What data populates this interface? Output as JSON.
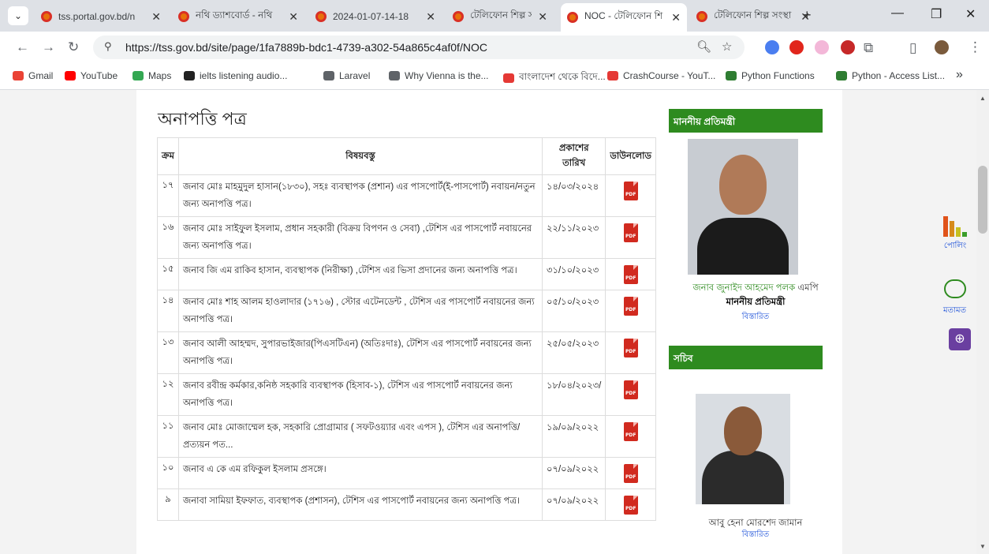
{
  "browser": {
    "tabs": [
      {
        "title": "tss.portal.gov.bd/n",
        "active": false
      },
      {
        "title": "নথি ড্যাশবোর্ড - নথি",
        "active": false
      },
      {
        "title": "2024-01-07-14-18",
        "active": false
      },
      {
        "title": "টেলিফোন শিল্প সংস্থা",
        "active": false
      },
      {
        "title": "NOC - টেলিফোন শি",
        "active": true
      },
      {
        "title": "টেলিফোন শিল্প সংস্থা",
        "active": false
      }
    ],
    "new_tab": "+",
    "url": "https://tss.gov.bd/site/page/1fa7889b-bdc1-4739-a302-54a865c4af0f/NOC",
    "bookmarks": [
      "Gmail",
      "YouTube",
      "Maps",
      "ielts listening audio...",
      "Laravel",
      "Why Vienna is the...",
      "বাংলাদেশ থেকে বিদে...",
      "CrashCourse - YouT...",
      "Python Functions",
      "Python - Access List..."
    ],
    "more_bookmarks": "»",
    "accent": "#2e8b1f"
  },
  "page": {
    "title": "অনাপত্তি পত্র",
    "table_headers": [
      "ক্রম",
      "বিষয়বস্তু",
      "প্রকাশের তারিখ",
      "ডাউনলোড"
    ],
    "rows": [
      {
        "sl": "১৭",
        "subject": "জনাব মোঃ মাহমুদুল হাসান(১৮৩০), সহঃ ব্যবস্থাপক (প্রশান) এর পাসপোর্ট(ই-পাসপোর্ট) নবায়ন/নতুন জন্য অনাপত্তি পত্র।",
        "date": "১৪/০৩/২০২৪"
      },
      {
        "sl": "১৬",
        "subject": "জনাব মোঃ সাইফুল ইসলাম, প্রধান সহকারী (বিক্রয় বিপণন ও সেবা) ,টেশিস এর পাসপোর্ট নবায়নের জন্য অনাপত্তি পত্র।",
        "date": "২২/১১/২০২৩"
      },
      {
        "sl": "১৫",
        "subject": "জনাব জি এম রাকিব হাসান, ব্যবস্থাপক (নিরীক্ষা) ,টেশিস এর ভিসা প্রদানের জন্য অনাপত্তি পত্র।",
        "date": "৩১/১০/২০২৩"
      },
      {
        "sl": "১৪",
        "subject": "জনাব মোঃ শাহ আলম হাওলাদার (১৭১৬) , স্টোর এটেনডেন্ট , টেশিস এর পাসপোর্ট নবায়নের জন্য অনাপত্তি পত্র।",
        "date": "০৫/১০/২০২৩"
      },
      {
        "sl": "১৩",
        "subject": "জনাব আলী আহম্মদ, সুপারভাইজার(পিএসটিএন) (অতিঃদাঃ), টেশিস এর পাসপোর্ট নবায়নের জন্য অনাপত্তি পত্র।",
        "date": "২৫/০৫/২০২৩"
      },
      {
        "sl": "১২",
        "subject": "জনাব রবীন্দ্র কর্মকার,কনিষ্ঠ সহকারি ব্যবস্থাপক (হিসাব-১), টেশিস এর পাসপোর্ট নবায়নের জন্য অনাপত্তি পত্র।",
        "date": "১৮/০৪/২০২৩/"
      },
      {
        "sl": "১১",
        "subject": "জনাব মোঃ মোজাম্মেল হক, সহকারি প্রোগ্রামার ( সফটওয়্যার এবং এপস ), টেশিস এর অনাপত্তি/ প্রত্যয়ন পত...",
        "date": "১৯/০৯/২০২২"
      },
      {
        "sl": "১০",
        "subject": "জনাব এ কে এম রফিকুল ইসলাম প্রসঙ্গে।",
        "date": "০৭/০৯/২০২২"
      },
      {
        "sl": "৯",
        "subject": "জনাবা সামিয়া ইফফাত, ব্যবস্থাপক (প্রশাসন), টেশিস এর পাসপোর্ট নবায়নের জন্য অনাপত্তি পত্র।",
        "date": "০৭/০৯/২০২২"
      }
    ],
    "pdf_label": "PDF"
  },
  "sidebar": {
    "minister_heading": "মাননীয় প্রতিমন্ত্রী",
    "minister_name": "জনাব জুনাইদ আহমেদ পলক",
    "minister_suffix": "এমপি",
    "minister_title": "মাননীয় প্রতিমন্ত্রী",
    "minister_more": "বিস্তারিত",
    "secretary_heading": "সচিব",
    "secretary_name": "আবু হেনা মোরশেদ জামান",
    "secretary_more": "বিস্তারিত"
  },
  "floating": {
    "poll": "পোলিং",
    "feedback": "মতামত"
  }
}
